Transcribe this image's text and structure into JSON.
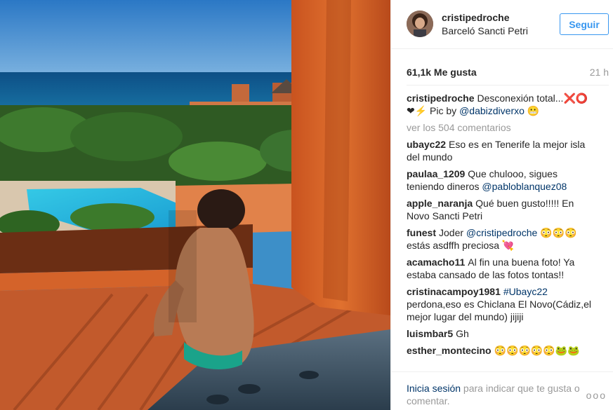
{
  "post": {
    "username": "cristipedroche",
    "location": "Barceló Sancti Petri",
    "follow_label": "Seguir",
    "likes": "61,1k Me gusta",
    "time_ago": "21 h"
  },
  "caption": {
    "user": "cristipedroche",
    "text_1": "Desconexión total...❌⭕❤⚡ Pic by",
    "mention": "@dabizdiverxo",
    "text_2": "😬"
  },
  "view_all": "ver los 504 comentarios",
  "comments": [
    {
      "user": "ubayc22",
      "parts": [
        {
          "t": "Eso es en Tenerife la mejor isla del mundo"
        }
      ]
    },
    {
      "user": "paulaa_1209",
      "parts": [
        {
          "t": "Que chulooo, sigues teniendo dineros "
        },
        {
          "t": "@pabloblanquez08",
          "link": true
        }
      ]
    },
    {
      "user": "apple_naranja",
      "parts": [
        {
          "t": "Qué buen gusto!!!!! En Novo Sancti Petri"
        }
      ]
    },
    {
      "user": "funest",
      "parts": [
        {
          "t": "Joder "
        },
        {
          "t": "@cristipedroche",
          "link": true
        },
        {
          "t": " 😳😳😳 estás asdffh preciosa 💘"
        }
      ]
    },
    {
      "user": "acamacho11",
      "parts": [
        {
          "t": "Al fin una buena foto! Ya estaba cansado de las fotos tontas!!"
        }
      ]
    },
    {
      "user": "cristinacampoy1981",
      "parts": [
        {
          "t": "#Ubayc22",
          "link": true
        },
        {
          "t": " perdona,eso es Chiclana El Novo(Cádiz,el mejor lugar del mundo) jijiji"
        }
      ]
    },
    {
      "user": "luismbar5",
      "parts": [
        {
          "t": "Gh"
        }
      ]
    },
    {
      "user": "esther_montecino",
      "parts": [
        {
          "t": "😳😳😳😳😳🐸🐸"
        }
      ]
    }
  ],
  "footer": {
    "login_link": "Inicia sesión",
    "login_rest": " para indicar que te gusta o comentar.",
    "more_icon": "ellipsis-icon",
    "more_glyph": "ooo"
  },
  "colors": {
    "link": "#003569",
    "accent": "#3897f0",
    "muted": "#999999"
  }
}
